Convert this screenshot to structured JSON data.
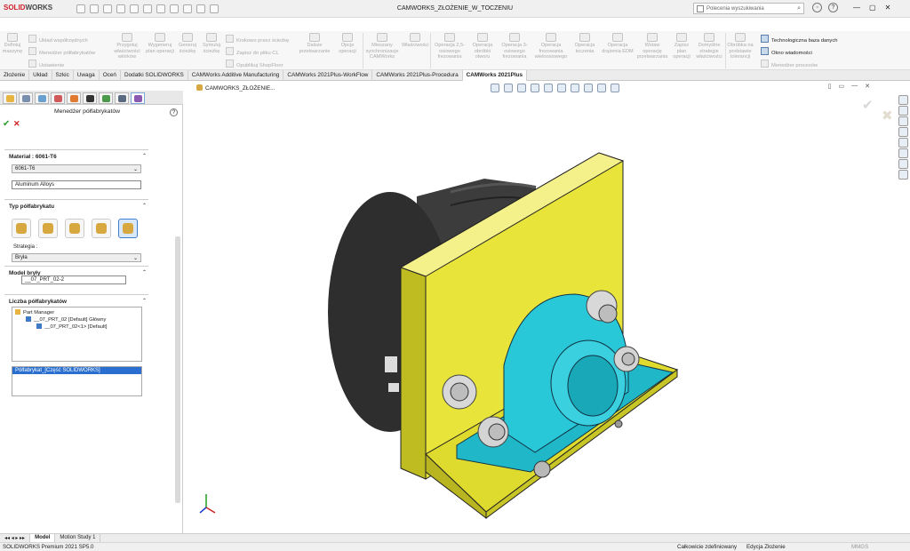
{
  "app": {
    "logo_brand": "SOLID",
    "logo_brand2": "WORKS",
    "document_title": "CAMWORKS_ZŁOŻENIE_W_TOCZENIU",
    "search_placeholder": "Polecenia wyszukiwania"
  },
  "ribbon": {
    "buttons": [
      "Definiuj maszynę",
      "Przygotuj właściwości wiórków",
      "Wygeneruj plan operacji",
      "Generuj ścieżkę",
      "Symuluj ścieżkę",
      "Dalsze przetwarzanie",
      "Opcje operacji",
      "Mieszany synchronizacje CAMWorks",
      "Właściwości",
      "Operacja 2,5-osiowego frezowania",
      "Operacja obróbki otworu",
      "Operacja 3-osiowego frezowania",
      "Operacja frezowania wieloosiowego",
      "Operacja toczenia",
      "Operacja drążenia EDM",
      "Wstaw operację przetwarzania",
      "Zapisz plan operacji",
      "Domyślne strategie właściwości",
      "Obróbka na podstawie tolerancji"
    ],
    "small_left": [
      "Układ współrzędnych",
      "Menedżer półfabrykatów",
      "Ustawienie"
    ],
    "small_mid": [
      "Krokowo przez ścieżkę",
      "Zapisz do pliku CL",
      "Opublikuj ShopFloor"
    ],
    "small_right": [
      "Technologiczna baza danych",
      "Okno wiadomości",
      "Menedżer procesów"
    ]
  },
  "tabs": [
    {
      "label": "Złożenie",
      "active": false
    },
    {
      "label": "Układ",
      "active": false
    },
    {
      "label": "Szkic",
      "active": false
    },
    {
      "label": "Uwaga",
      "active": false
    },
    {
      "label": "Oceń",
      "active": false
    },
    {
      "label": "Dodatki SOLIDWORKS",
      "active": false
    },
    {
      "label": "CAMWorks Additive Manufacturing",
      "active": false
    },
    {
      "label": "CAMWorks 2021Plus-WorkFlow",
      "active": false
    },
    {
      "label": "CAMWorks 2021Plus-Procedura",
      "active": false
    },
    {
      "label": "CAMWorks 2021Plus",
      "active": true
    }
  ],
  "panel": {
    "title": "Menedżer półfabrykatów",
    "material": {
      "header": "Materiał : 6061-T6",
      "selected": "6061-T6",
      "category": "Aluminum Alloys"
    },
    "stock_type": {
      "header": "Typ półfabrykatu",
      "strategy_label": "Strategia :",
      "strategy_value": "Bryła"
    },
    "solid_model": {
      "header": "Model bryły",
      "value": "__07_PRT_02-2"
    },
    "stock_count": {
      "header": "Liczba półfabrykatów",
      "tree": [
        "Part Manager",
        "__07_PRT_02 [Default] Główny",
        "__07_PRT_02<1> [Default]"
      ],
      "list_item": "Półfabrykat_[Część SOLIDWORKS]"
    }
  },
  "graphics": {
    "breadcrumb": "CAMWORKS_ZŁOŻENIE..."
  },
  "bottom_tabs": [
    {
      "label": "Model",
      "active": true
    },
    {
      "label": "Motion Study 1",
      "active": false
    }
  ],
  "status": {
    "product": "SOLIDWORKS Premium 2021 SP5.0",
    "definition": "Całkowicie zdefiniowany",
    "mode": "Edycja Złożenie",
    "units": "MMGS"
  },
  "colors": {
    "plate": "#e8e43a",
    "bearing": "#29c8d8",
    "chuck": "#3a3a3a",
    "accent_blue": "#2a6fd0"
  }
}
